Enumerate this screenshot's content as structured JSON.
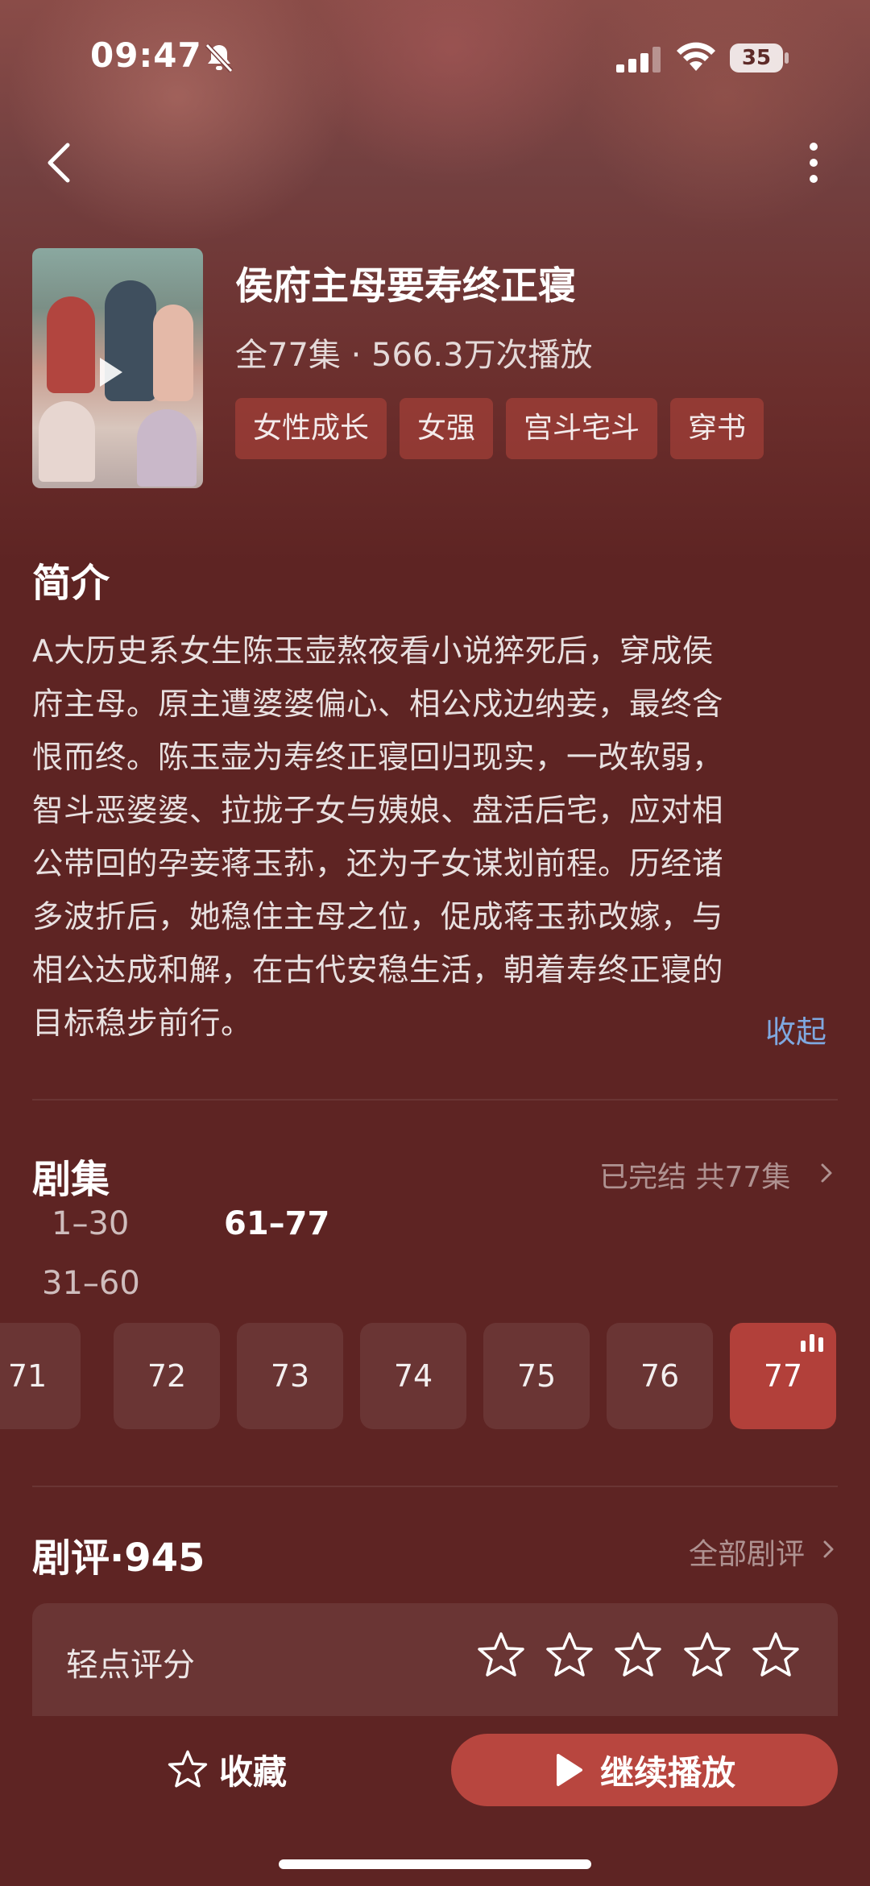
{
  "status_bar": {
    "time": "09:47",
    "battery": "35"
  },
  "header": {
    "title": "侯府主母要寿终正寝",
    "stats": "全77集 · 566.3万次播放",
    "tags": [
      "女性成长",
      "女强",
      "宫斗宅斗",
      "穿书"
    ]
  },
  "intro": {
    "title": "简介",
    "lines": [
      "A大历史系女生陈玉壶熬夜看小说猝死后，穿成侯",
      "府主母。原主遭婆婆偏心、相公戍边纳妾，最终含",
      "恨而终。陈玉壶为寿终正寝回归现实，一改软弱，",
      "智斗恶婆婆、拉拢子女与姨娘、盘活后宅，应对相",
      "公带回的孕妾蒋玉荪，还为子女谋划前程。历经诸",
      "多波折后，她稳住主母之位，促成蒋玉荪改嫁，与",
      "相公达成和解，在古代安稳生活，朝着寿终正寝的",
      "目标稳步前行。"
    ],
    "collapse_label": "收起"
  },
  "episodes": {
    "title": "剧集",
    "status": "已完结 共77集",
    "ranges": [
      "1–30",
      "61–77",
      "31–60"
    ],
    "active_range": "61–77",
    "items": [
      "71",
      "72",
      "73",
      "74",
      "75",
      "76",
      "77"
    ],
    "current": "77"
  },
  "reviews": {
    "title": "剧评·945",
    "all_label": "全部剧评",
    "rating_label": "轻点评分",
    "rating_value": 0,
    "rating_max": 5
  },
  "bottom": {
    "favorite_label": "收藏",
    "play_label": "继续播放"
  },
  "colors": {
    "background": "#5e2423",
    "accent": "#b8463f",
    "link": "#7fa8e0"
  },
  "icons": [
    "bell-mute-icon",
    "signal-icon",
    "wifi-icon",
    "battery-icon",
    "back-icon",
    "more-icon",
    "chevron-right-icon",
    "star-icon",
    "play-icon",
    "playing-bars-icon"
  ]
}
